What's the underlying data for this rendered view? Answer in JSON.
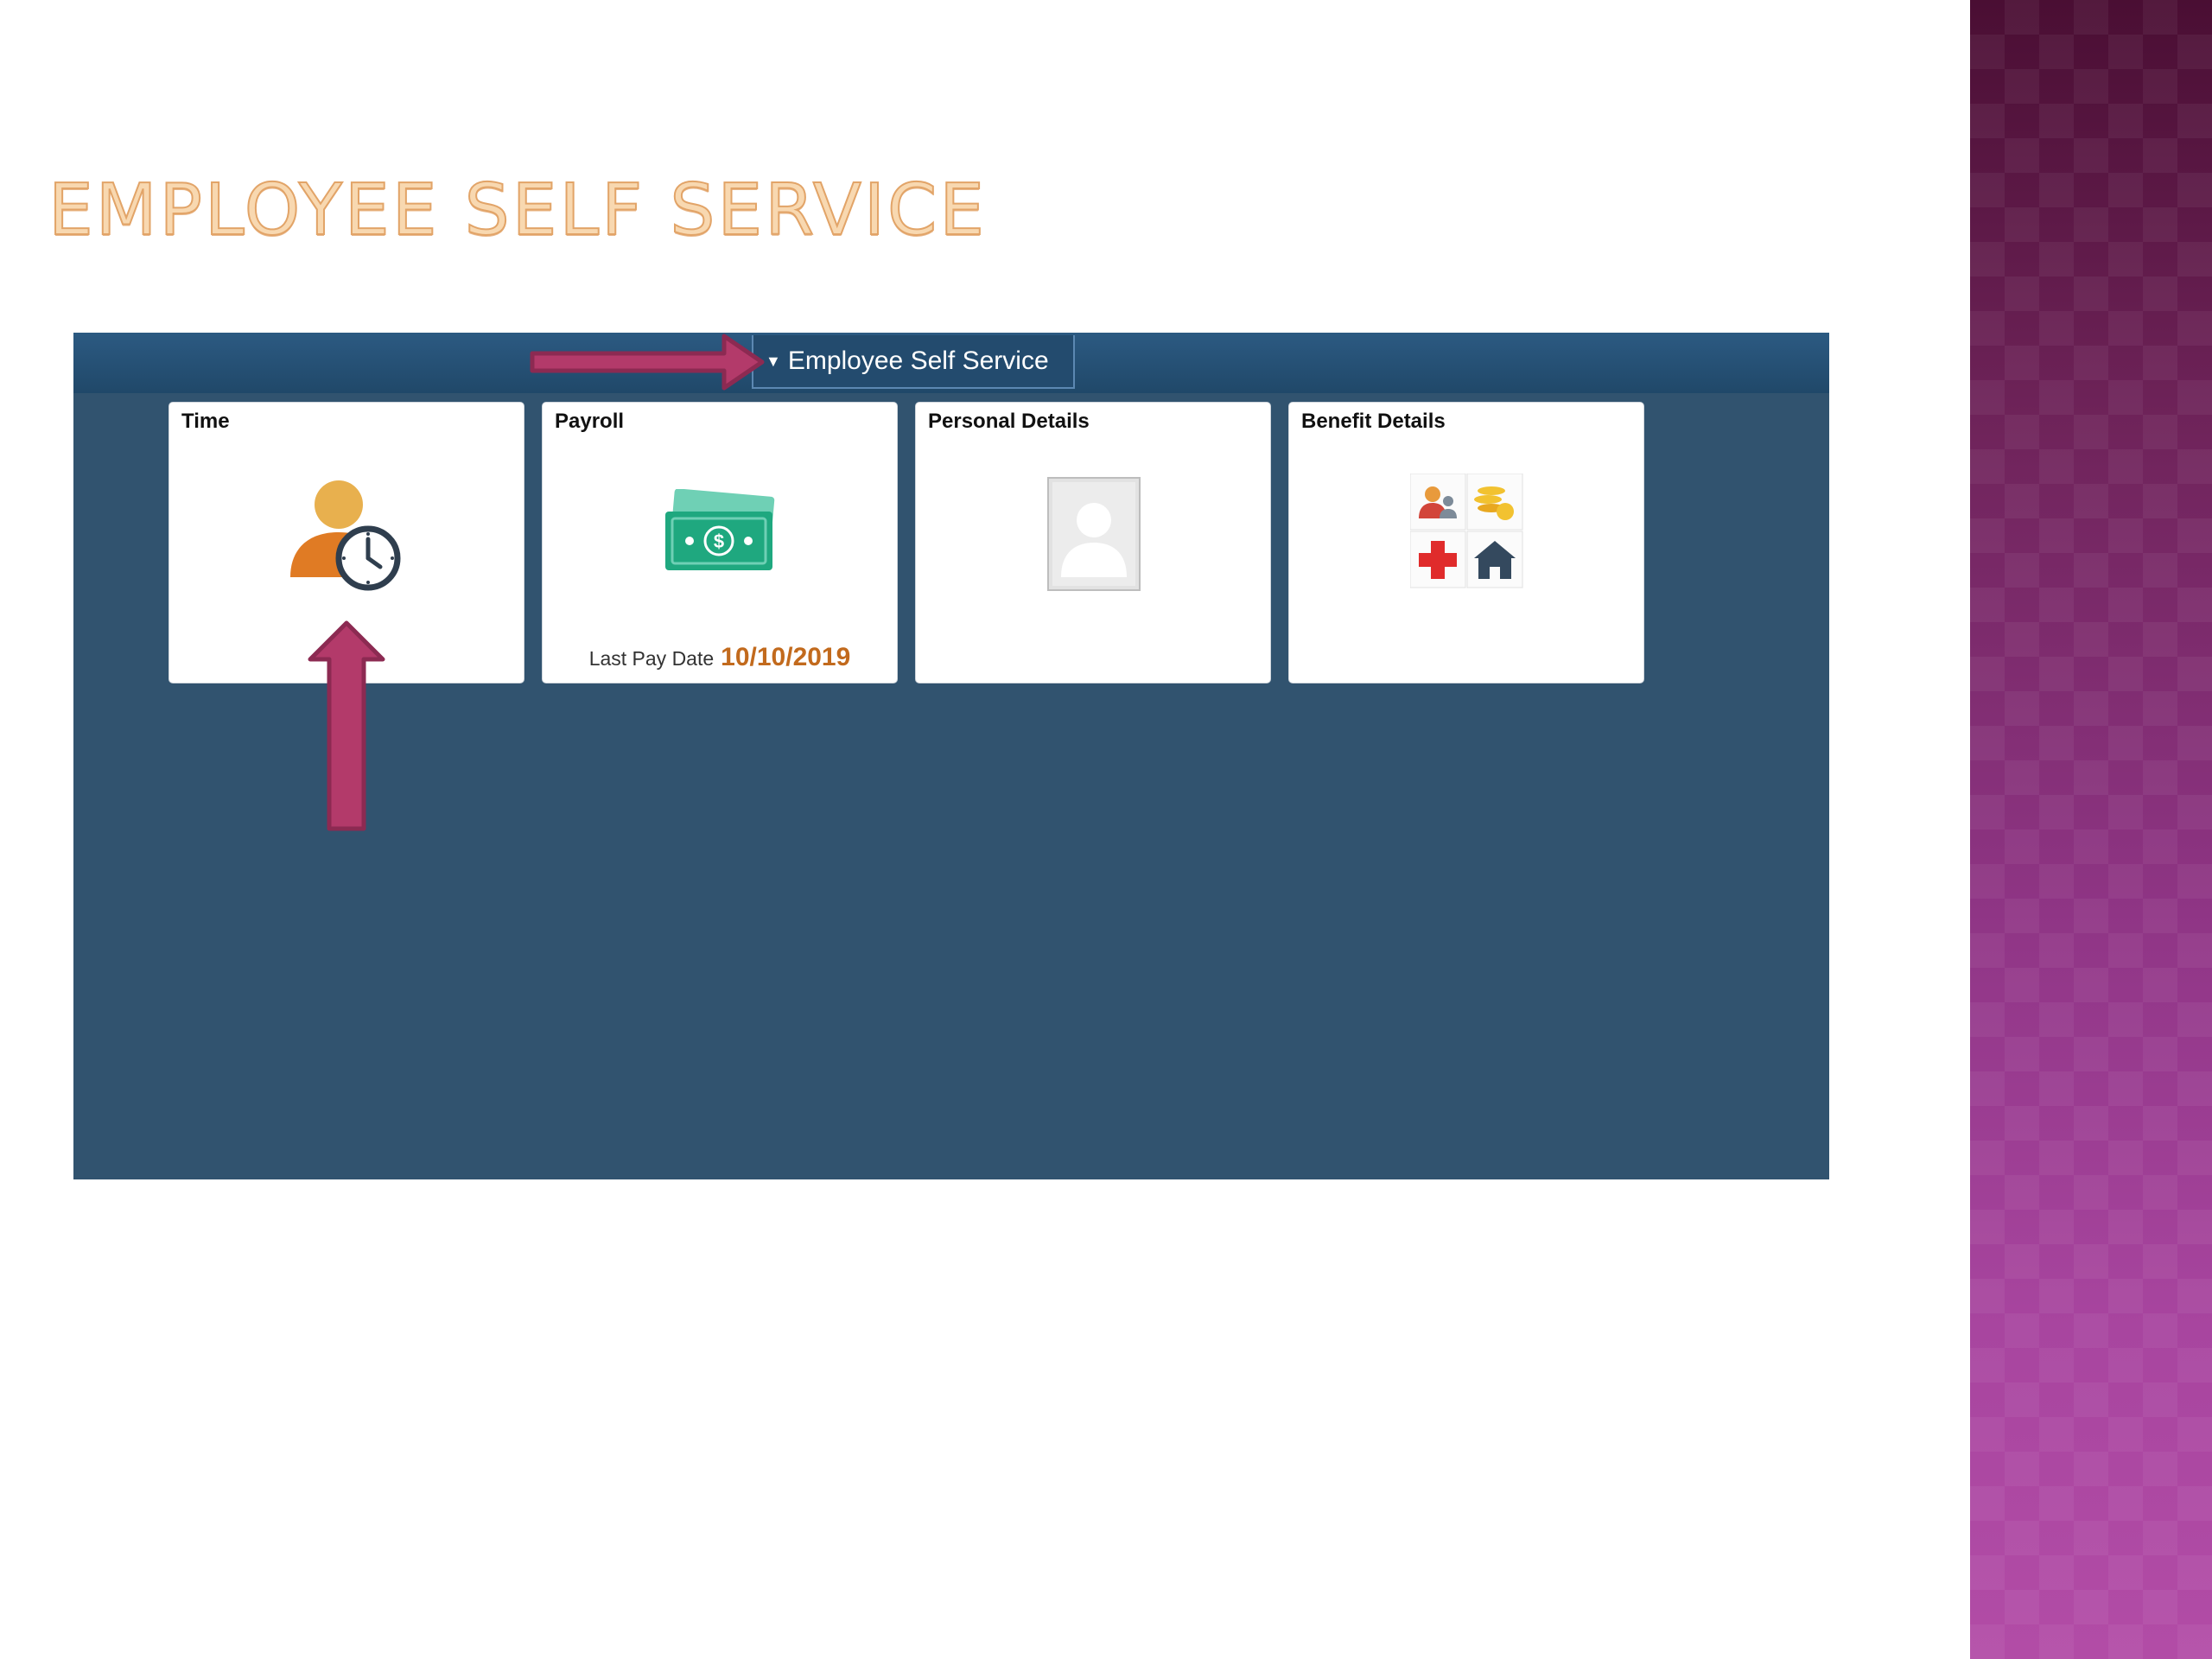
{
  "slide": {
    "title": "Employee Self Service"
  },
  "banner": {
    "title": "Employee Self Service",
    "caret_icon": "caret-down-icon"
  },
  "tiles": {
    "time": {
      "title": "Time",
      "icon": "person-clock-icon"
    },
    "payroll": {
      "title": "Payroll",
      "icon": "cash-icon",
      "footer_label": "Last Pay Date",
      "footer_value": "10/10/2019"
    },
    "personal": {
      "title": "Personal Details",
      "icon": "profile-placeholder-icon"
    },
    "benefits": {
      "title": "Benefit Details",
      "icon": "benefits-grid-icon"
    }
  },
  "colors": {
    "banner": "#2c5a82",
    "background": "#31536f",
    "arrow": "#b33a6a",
    "accent_date": "#c26a1d",
    "title": "#f8d8b0"
  }
}
